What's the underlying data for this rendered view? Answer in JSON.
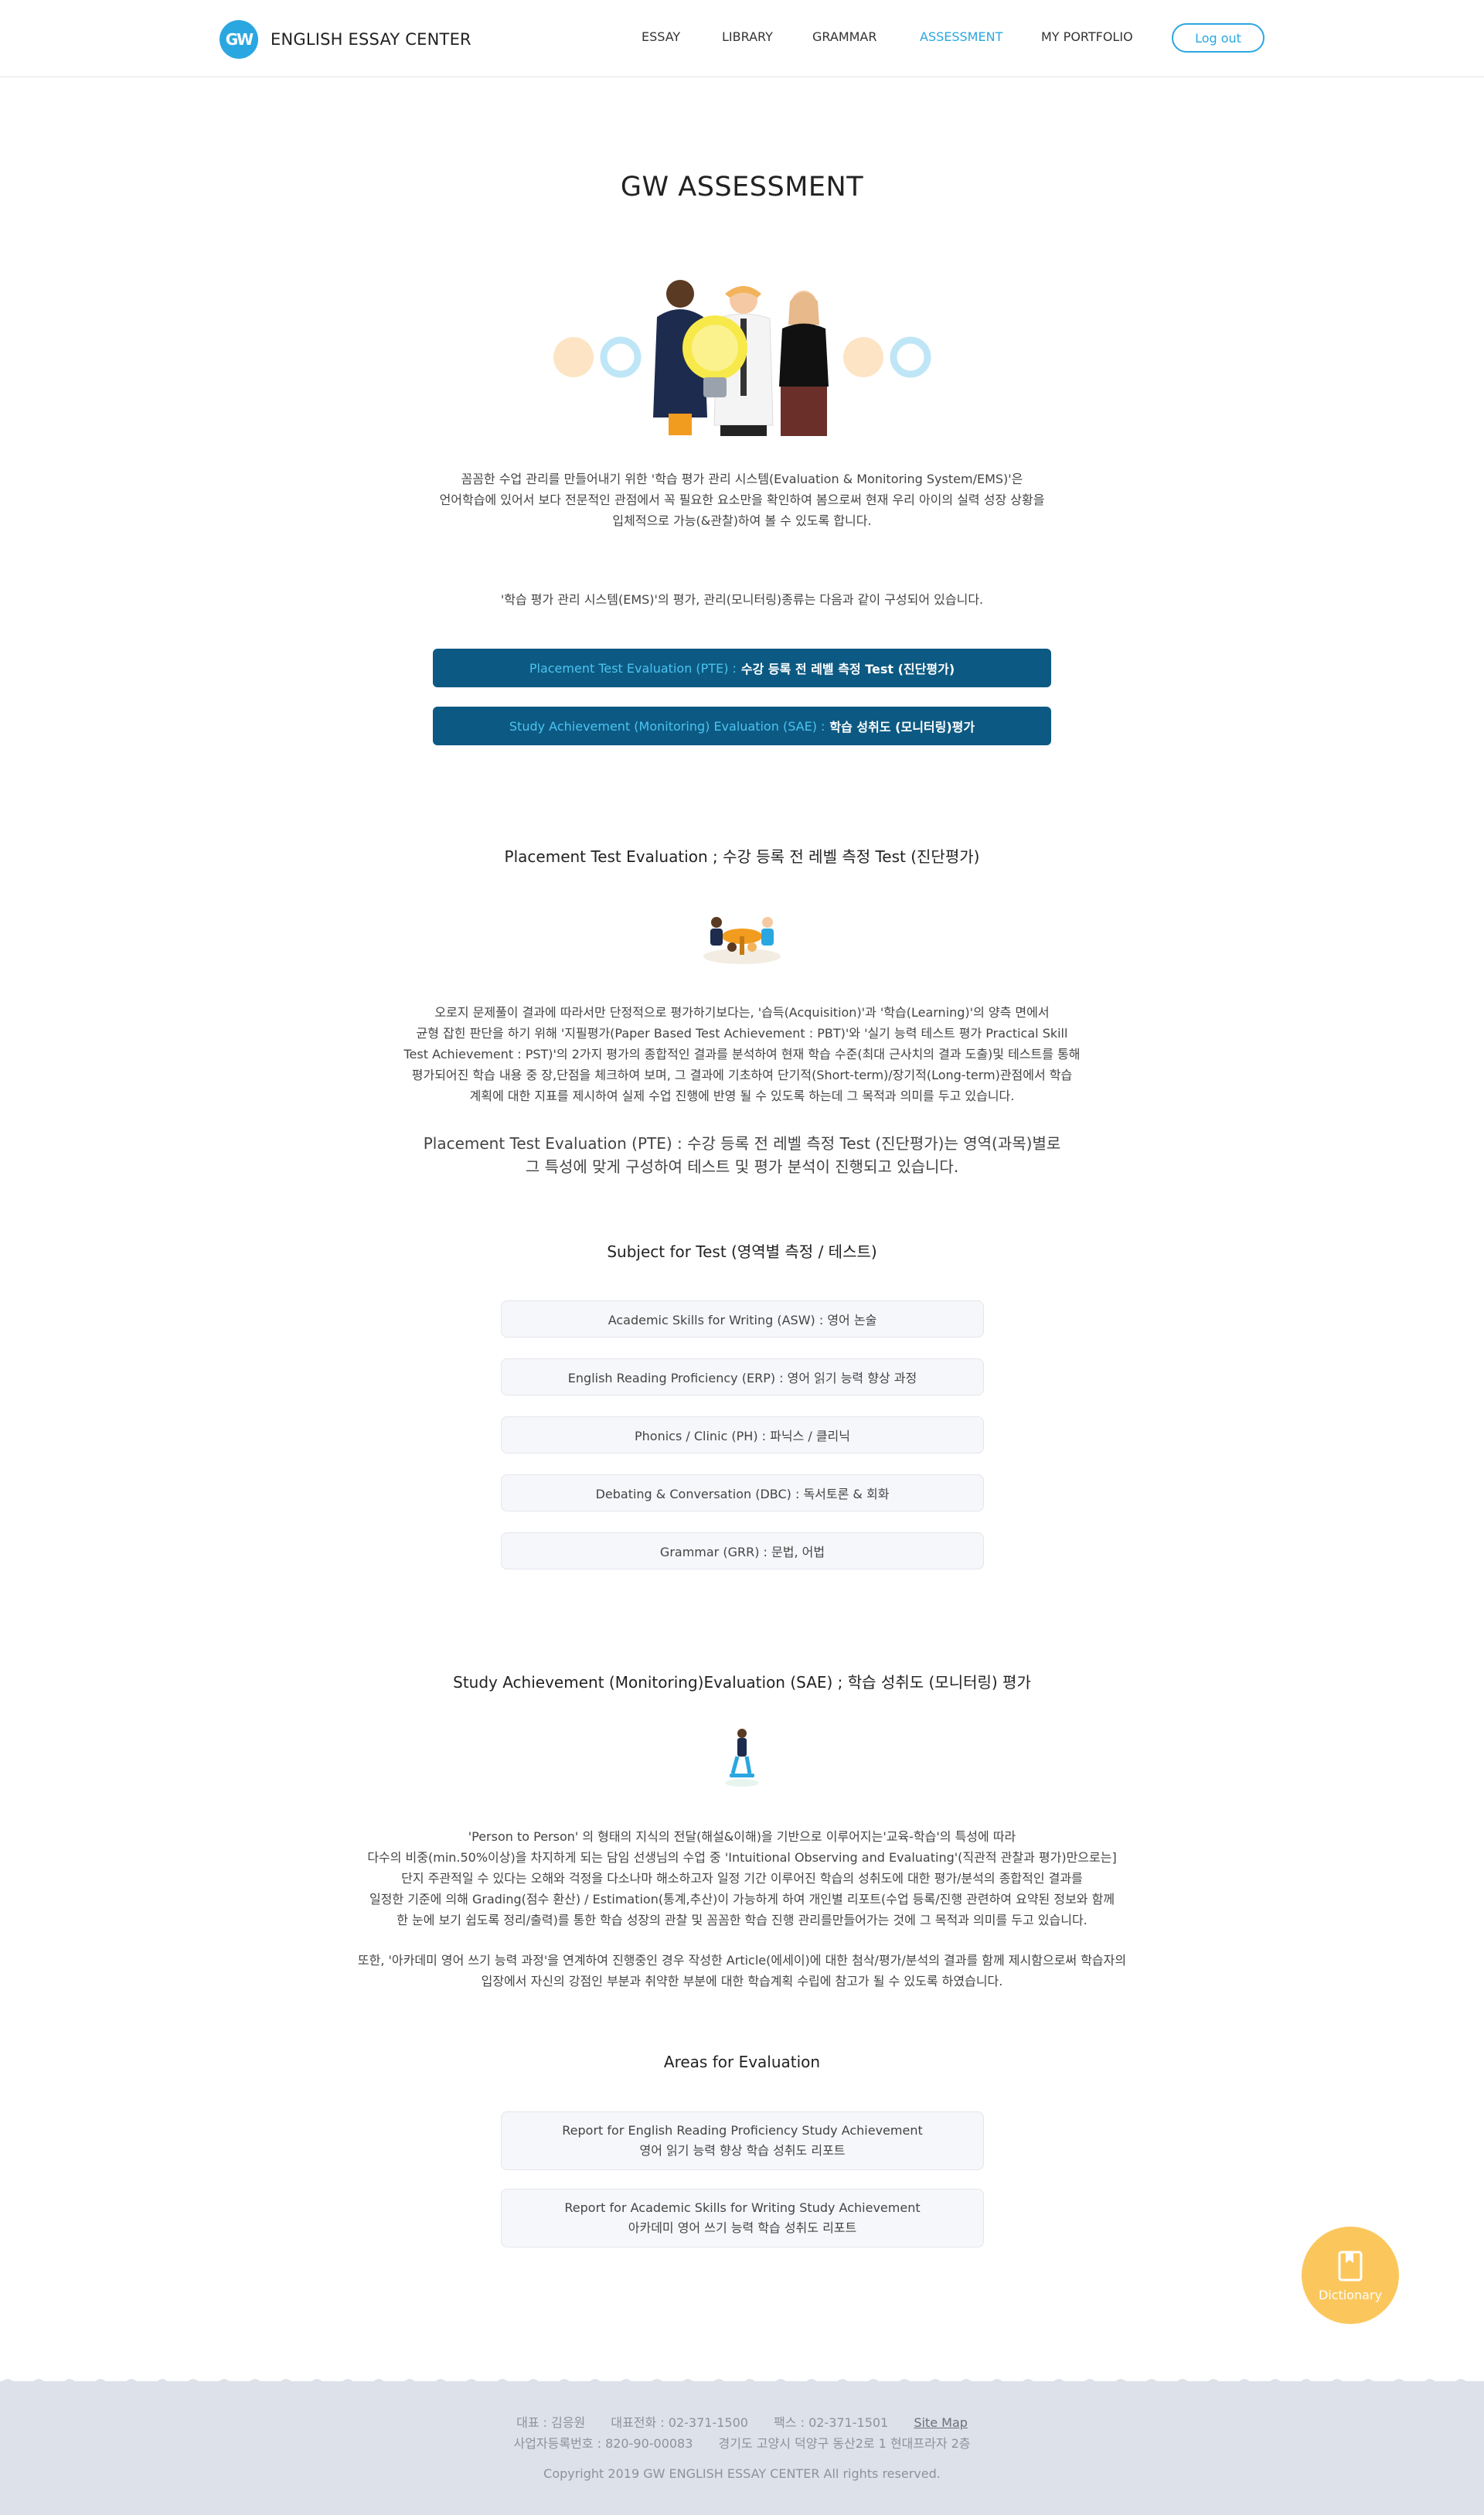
{
  "header": {
    "logo_mark": "GW",
    "logo_text": "ENGLISH ESSAY CENTER",
    "nav": [
      "ESSAY",
      "LIBRARY",
      "GRAMMAR",
      "ASSESSMENT",
      "MY PORTFOLIO"
    ],
    "active_nav": "ASSESSMENT",
    "logout_label": "Log out"
  },
  "page_title": "GW ASSESSMENT",
  "intro": [
    "꼼꼼한 수업 관리를 만들어내기 위한 '학습 평가 관리 시스템(Evaluation & Monitoring System/EMS)'은",
    "언어학습에 있어서 보다 전문적인 관점에서 꼭 필요한 요소만을 확인하여 봄으로써 현재 우리 아이의 실력 성장 상황을",
    "입체적으로 가능(&관찰)하여 볼 수 있도록 합니다."
  ],
  "intro2": "'학습 평가 관리 시스템(EMS)'의 평가, 관리(모니터링)종류는 다음과 같이 구성되어 있습니다.",
  "buttons": [
    {
      "en": "Placement Test Evaluation (PTE) :",
      "ko": "수강 등록 전 레벨 측정 Test (진단평가)"
    },
    {
      "en": "Study Achievement (Monitoring) Evaluation (SAE) :",
      "ko": "학습 성취도 (모니터링)평가"
    }
  ],
  "pte": {
    "title": "Placement Test Evaluation ; 수강 등록 전 레벨 측정 Test (진단평가)",
    "body": [
      "오로지 문제풀이 결과에 따라서만 단정적으로 평가하기보다는, '습득(Acquisition)'과 '학습(Learning)'의 양측 면에서",
      "균형 잡힌 판단을 하기 위해 '지필평가(Paper Based Test Achievement : PBT)'와 '실기 능력 테스트 평가 Practical Skill",
      "Test Achievement : PST)'의 2가지 평가의 종합적인 결과를 분석하여 현재 학습 수준(최대 근사치의 결과 도출)및 테스트를 통해",
      "평가되어진 학습 내용 중 장,단점을 체크하여 보며, 그 결과에 기초하여 단기적(Short-term)/장기적(Long-term)관점에서 학습",
      "계획에 대한 지표를 제시하여 실제 수업 진행에 반영 될 수 있도록 하는데 그 목적과 의미를 두고 있습니다."
    ],
    "emphasis": [
      "Placement Test Evaluation (PTE) : 수강 등록 전 레벨 측정 Test (진단평가)는 영역(과목)별로",
      "그 특성에 맞게 구성하여 테스트 및 평가 분석이 진행되고 있습니다."
    ]
  },
  "subjects": {
    "title": "Subject for Test (영역별 측정 / 테스트)",
    "items": [
      "Academic Skills for Writing (ASW) : 영어 논술",
      "English Reading Proficiency (ERP) : 영어 읽기 능력 향상 과정",
      "Phonics / Clinic (PH) : 파닉스 / 클리닉",
      "Debating & Conversation (DBC) : 독서토론 & 회화",
      "Grammar (GRR) : 문법, 어법"
    ]
  },
  "sae": {
    "title": "Study Achievement (Monitoring)Evaluation (SAE) ; 학습 성취도 (모니터링) 평가",
    "body": [
      "'Person to Person' 의 형태의 지식의 전달(해설&이해)을 기반으로 이루어지는'교육-학습'의 특성에 따라",
      "다수의 비중(min.50%이상)을 차지하게 되는 담임 선생님의 수업 중 'Intuitional Observing and Evaluating'(직관적 관찰과 평가)만으로는]",
      "단지 주관적일 수 있다는 오해와 걱정을 다소나마 해소하고자 일정 기간 이루어진 학습의 성취도에 대한 평가/분석의 종합적인 결과를",
      "일정한 기준에 의해 Grading(점수 환산) / Estimation(통계,추산)이 가능하게 하여 개인별 리포트(수업 등록/진행 관련하여 요약된 정보와 함께",
      "한 눈에 보기 쉽도록 정리/출력)를 통한 학습 성장의 관찰 및 꼼꼼한 학습 진행 관리를만들어가는 것에 그 목적과 의미를 두고 있습니다."
    ],
    "body2": [
      "또한, '아카데미 영어 쓰기 능력 과정'을 연계하여 진행중인 경우 작성한 Article(에세이)에 대한 첨삭/평가/분석의 결과를 함께 제시함으로써 학습자의",
      "입장에서 자신의 강점인 부분과 취약한 부분에 대한 학습계획 수립에 참고가 될 수 있도록 하였습니다."
    ]
  },
  "areas": {
    "title": "Areas for Evaluation",
    "items": [
      {
        "en": "Report for English Reading Proficiency Study Achievement",
        "ko": "영어 읽기 능력 향상 학습 성취도 리포트"
      },
      {
        "en": "Report for Academic Skills for Writing Study Achievement",
        "ko": "아카데미 영어 쓰기 능력 학습 성취도 리포트"
      }
    ]
  },
  "dictionary_label": "Dictionary",
  "footer": {
    "ceo": "대표 : 김응원",
    "phone": "대표전화 : 02-371-1500",
    "fax": "팩스 : 02-371-1501",
    "sitemap": "Site Map",
    "bizno": "사업자등록번호 : 820-90-00083",
    "address": "경기도 고양시 덕양구 동산2로 1 현대프라자 2층",
    "copyright": "Copyright 2019 GW ENGLISH ESSAY CENTER All rights reserved."
  },
  "colors": {
    "accent": "#2aa7e0",
    "button_dark": "#0c5a83",
    "dictionary": "#fbc75d",
    "footer_bg": "#dde1ea"
  }
}
